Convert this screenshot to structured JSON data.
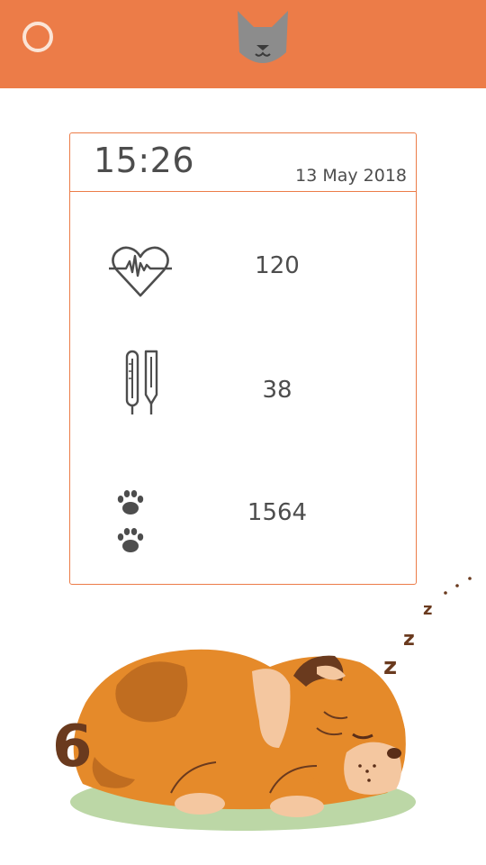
{
  "header": {
    "menu_icon": "ring-icon",
    "logo_icon": "cat-face-icon",
    "background_color": "#ec7c48"
  },
  "card": {
    "time": "15:26",
    "date": "13 May 2018",
    "accent_color": "#ec7c48",
    "metrics": [
      {
        "icon": "heart-rate-icon",
        "value": "120"
      },
      {
        "icon": "thermometer-icon",
        "value": "38"
      },
      {
        "icon": "paw-prints-icon",
        "value": "1564"
      }
    ]
  },
  "illustration": {
    "name": "sleeping-pug-illustration",
    "sleep_letters": [
      "z",
      "z",
      "z"
    ]
  }
}
